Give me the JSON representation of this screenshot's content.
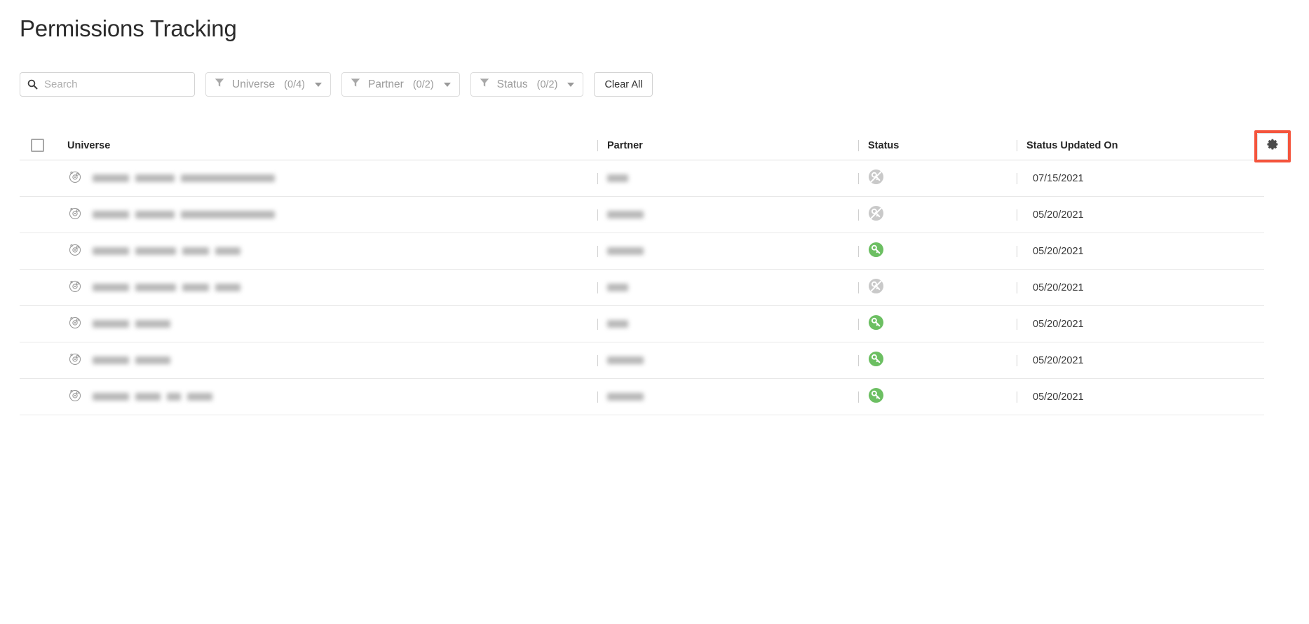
{
  "page": {
    "title": "Permissions Tracking"
  },
  "search": {
    "placeholder": "Search",
    "value": "",
    "icon": "search-icon"
  },
  "filters": [
    {
      "label": "Universe",
      "count": "(0/4)",
      "selected": 0,
      "total": 4,
      "icon": "funnel-icon",
      "caret": "chevron-down-icon"
    },
    {
      "label": "Partner",
      "count": "(0/2)",
      "selected": 0,
      "total": 2,
      "icon": "funnel-icon",
      "caret": "chevron-down-icon"
    },
    {
      "label": "Status",
      "count": "(0/2)",
      "selected": 0,
      "total": 2,
      "icon": "funnel-icon",
      "caret": "chevron-down-icon"
    }
  ],
  "clear_all_label": "Clear All",
  "table": {
    "select_all_checked": false,
    "columns": [
      {
        "key": "universe",
        "label": "Universe"
      },
      {
        "key": "partner",
        "label": "Partner"
      },
      {
        "key": "status",
        "label": "Status"
      },
      {
        "key": "updated",
        "label": "Status Updated On"
      }
    ],
    "rows": [
      {
        "universe": "",
        "universe_redacted": true,
        "universe_icon": "universe-orbit-icon",
        "universe_widths": [
          52,
          56,
          134
        ],
        "partner": "",
        "partner_redacted": true,
        "partner_width": 30,
        "status": "restricted",
        "status_icon": "key-slashed-icon",
        "updated": "07/15/2021"
      },
      {
        "universe": "",
        "universe_redacted": true,
        "universe_icon": "universe-orbit-icon",
        "universe_widths": [
          52,
          56,
          134
        ],
        "partner": "",
        "partner_redacted": true,
        "partner_width": 52,
        "status": "restricted",
        "status_icon": "key-slashed-icon",
        "updated": "05/20/2021"
      },
      {
        "universe": "",
        "universe_redacted": true,
        "universe_icon": "universe-orbit-icon",
        "universe_widths": [
          52,
          58,
          38,
          36
        ],
        "partner": "",
        "partner_redacted": true,
        "partner_width": 52,
        "status": "permitted",
        "status_icon": "key-icon",
        "updated": "05/20/2021"
      },
      {
        "universe": "",
        "universe_redacted": true,
        "universe_icon": "universe-orbit-icon",
        "universe_widths": [
          52,
          58,
          38,
          36
        ],
        "partner": "",
        "partner_redacted": true,
        "partner_width": 30,
        "status": "restricted",
        "status_icon": "key-slashed-icon",
        "updated": "05/20/2021"
      },
      {
        "universe": "",
        "universe_redacted": true,
        "universe_icon": "universe-orbit-icon",
        "universe_widths": [
          52,
          50
        ],
        "partner": "",
        "partner_redacted": true,
        "partner_width": 30,
        "status": "permitted",
        "status_icon": "key-icon",
        "updated": "05/20/2021"
      },
      {
        "universe": "",
        "universe_redacted": true,
        "universe_icon": "universe-orbit-icon",
        "universe_widths": [
          52,
          50
        ],
        "partner": "",
        "partner_redacted": true,
        "partner_width": 52,
        "status": "permitted",
        "status_icon": "key-icon",
        "updated": "05/20/2021"
      },
      {
        "universe": "",
        "universe_redacted": true,
        "universe_icon": "universe-orbit-icon",
        "universe_widths": [
          52,
          36,
          20,
          36
        ],
        "partner": "",
        "partner_redacted": true,
        "partner_width": 52,
        "status": "permitted",
        "status_icon": "key-icon",
        "updated": "05/20/2021"
      }
    ]
  },
  "settings_button": {
    "icon": "gear-icon",
    "highlighted": true,
    "highlight_color": "#f4543c"
  },
  "colors": {
    "status_permitted": "#6cbf62",
    "status_restricted": "#c9c9c9",
    "text_primary": "#2b2b2b",
    "text_muted": "#9a9a9a",
    "border": "#e8e8e8",
    "highlight": "#f4543c"
  }
}
